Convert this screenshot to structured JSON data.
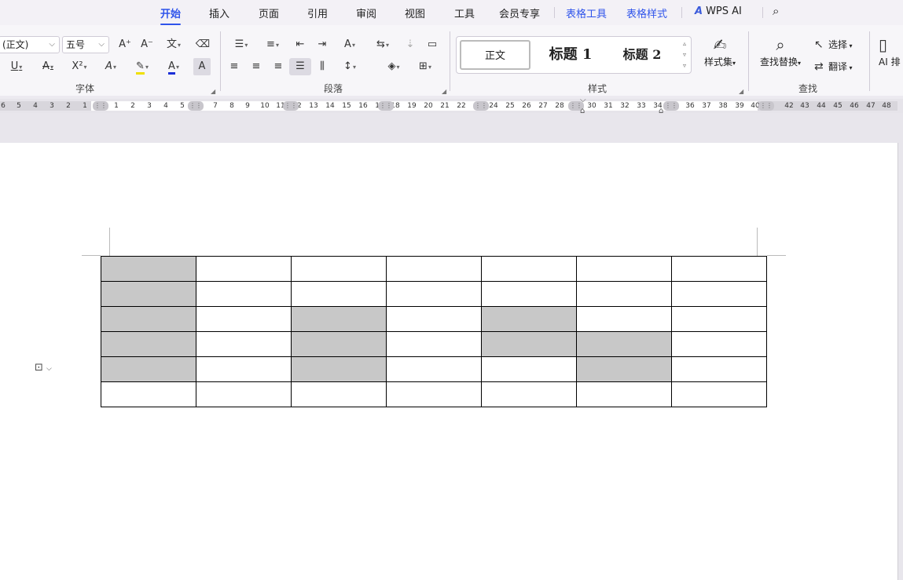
{
  "tabs": [
    "开始",
    "插入",
    "页面",
    "引用",
    "审阅",
    "视图",
    "工具",
    "会员专享"
  ],
  "context_tabs": [
    "表格工具",
    "表格样式"
  ],
  "ai_tab": "WPS AI",
  "ribbon": {
    "font": {
      "font_name": "(正文)",
      "font_size": "五号",
      "group_label": "字体"
    },
    "paragraph": {
      "group_label": "段落"
    },
    "styles": {
      "items": [
        "正文",
        "标题 1",
        "标题 2"
      ],
      "style_set_label": "样式集",
      "group_label": "样式"
    },
    "find": {
      "find_replace_label": "查找替换",
      "select_label": "选择",
      "translate_label": "翻译",
      "group_label": "查找"
    },
    "ai_layout_label": "AI 排"
  },
  "ruler": {
    "ticks": [
      "6",
      "5",
      "4",
      "3",
      "2",
      "1",
      "1",
      "2",
      "3",
      "4",
      "5",
      "7",
      "8",
      "9",
      "10",
      "11",
      "12",
      "13",
      "14",
      "15",
      "16",
      "17",
      "18",
      "19",
      "20",
      "21",
      "22",
      "24",
      "25",
      "26",
      "27",
      "28",
      "30",
      "31",
      "32",
      "33",
      "34",
      "36",
      "37",
      "38",
      "39",
      "40",
      "42",
      "43",
      "44",
      "45",
      "46",
      "47",
      "48"
    ]
  },
  "table": {
    "rows": 6,
    "cols": 7,
    "shaded_cells": [
      [
        0,
        0
      ],
      [
        1,
        0
      ],
      [
        2,
        0
      ],
      [
        2,
        2
      ],
      [
        2,
        4
      ],
      [
        3,
        0
      ],
      [
        3,
        2
      ],
      [
        3,
        4
      ],
      [
        3,
        5
      ],
      [
        4,
        0
      ],
      [
        4,
        2
      ],
      [
        4,
        5
      ]
    ]
  }
}
